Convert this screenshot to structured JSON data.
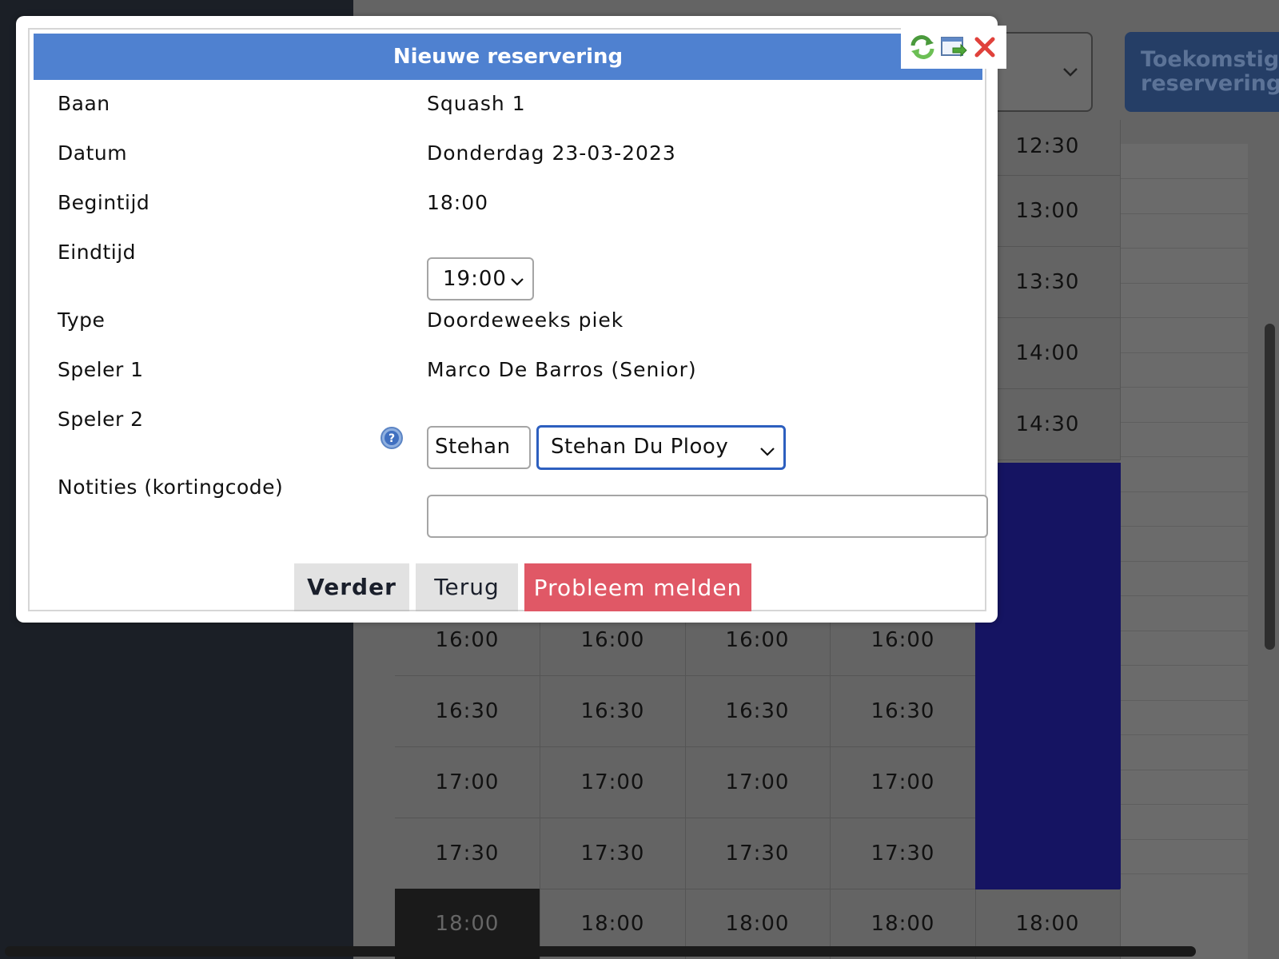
{
  "background": {
    "future_button_label": "Toekomstige reserveringen",
    "time_slots_partial": "12:30",
    "right_column_times": [
      "13:00",
      "13:30",
      "14:00",
      "14:30"
    ],
    "grid_times": [
      "16:00",
      "16:30",
      "17:00",
      "17:30",
      "18:00"
    ],
    "colors": {
      "booked": "#151462",
      "sidebar": "#1b1f26"
    }
  },
  "modal": {
    "title": "Nieuwe reservering",
    "fields": {
      "baan": {
        "label": "Baan",
        "value": "Squash 1"
      },
      "datum": {
        "label": "Datum",
        "value": "Donderdag 23-03-2023"
      },
      "begintijd": {
        "label": "Begintijd",
        "value": "18:00"
      },
      "eindtijd": {
        "label": "Eindtijd",
        "value": "19:00"
      },
      "type": {
        "label": "Type",
        "value": "Doordeweeks piek"
      },
      "speler1": {
        "label": "Speler 1",
        "value": "Marco De Barros (Senior)"
      },
      "speler2": {
        "label": "Speler 2",
        "search_value": "Stehan",
        "selected": "Stehan Du Plooy"
      },
      "notities": {
        "label": "Notities (kortingcode)",
        "value": ""
      }
    },
    "buttons": {
      "verder": "Verder",
      "terug": "Terug",
      "probleem": "Probleem melden"
    },
    "tools": [
      "refresh-icon",
      "new-window-icon",
      "close-icon"
    ],
    "colors": {
      "header": "#4f81d0",
      "danger": "#e05866"
    }
  }
}
